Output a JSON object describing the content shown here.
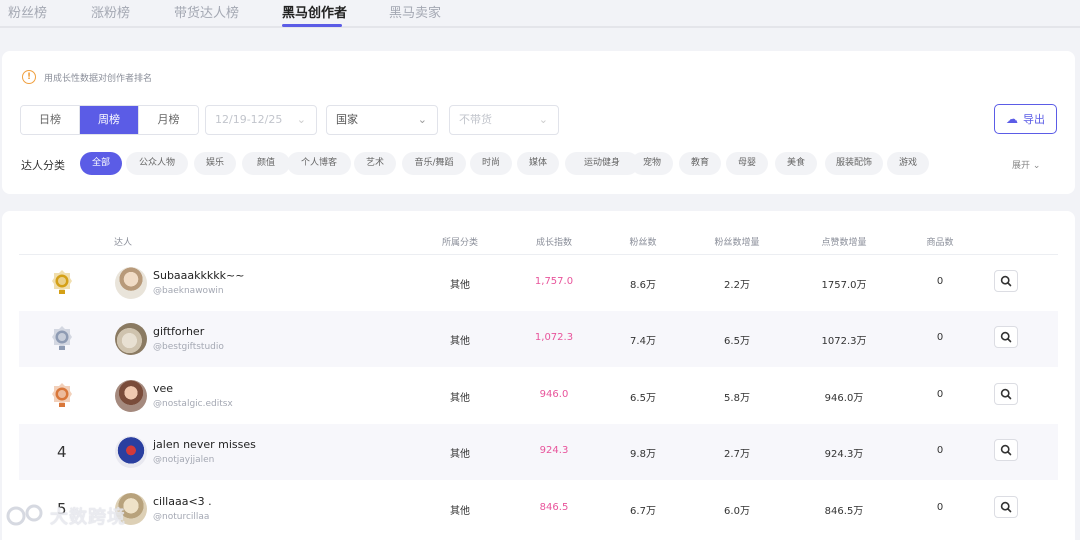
{
  "tabs": {
    "items": [
      "粉丝榜",
      "涨粉榜",
      "带货达人榜",
      "黑马创作者",
      "黑马卖家"
    ],
    "active_index": 3
  },
  "notice": {
    "text": "用成长性数据对创作者排名"
  },
  "period": {
    "items": [
      "日榜",
      "周榜",
      "月榜"
    ],
    "active_index": 1
  },
  "filters": {
    "date_range": "12/19-12/25",
    "country_placeholder": "国家",
    "goods_placeholder": "不带货"
  },
  "export_label": "导出",
  "categories": {
    "label": "达人分类",
    "items": [
      "全部",
      "公众人物",
      "娱乐",
      "颜值",
      "个人博客",
      "艺术",
      "音乐/舞蹈",
      "时尚",
      "媒体",
      "运动健身",
      "宠物",
      "教育",
      "母婴",
      "美食",
      "服装配饰",
      "游戏"
    ],
    "active_index": 0,
    "expand_label": "展开"
  },
  "table": {
    "headers": [
      "达人",
      "所属分类",
      "成长指数",
      "粉丝数",
      "粉丝数增量",
      "点赞数增量",
      "商品数"
    ],
    "rows": [
      {
        "rank": "",
        "medal": "gold",
        "name": "Subaaakkkkk~~",
        "handle": "@baeknawowin",
        "category": "其他",
        "growth": "1,757.0",
        "fans": "8.6万",
        "fans_inc": "2.2万",
        "likes_inc": "1757.0万",
        "goods": "0"
      },
      {
        "rank": "",
        "medal": "silver",
        "name": "giftforher",
        "handle": "@bestgiftstudio",
        "category": "其他",
        "growth": "1,072.3",
        "fans": "7.4万",
        "fans_inc": "6.5万",
        "likes_inc": "1072.3万",
        "goods": "0"
      },
      {
        "rank": "",
        "medal": "bronze",
        "name": "vee",
        "handle": "@nostalgic.editsx",
        "category": "其他",
        "growth": "946.0",
        "fans": "6.5万",
        "fans_inc": "5.8万",
        "likes_inc": "946.0万",
        "goods": "0"
      },
      {
        "rank": "4",
        "medal": "",
        "name": "jalen never misses",
        "handle": "@notjayjjalen",
        "category": "其他",
        "growth": "924.3",
        "fans": "9.8万",
        "fans_inc": "2.7万",
        "likes_inc": "924.3万",
        "goods": "0"
      },
      {
        "rank": "5",
        "medal": "",
        "name": "cillaaa<3 .",
        "handle": "@noturcillaa",
        "category": "其他",
        "growth": "846.5",
        "fans": "6.7万",
        "fans_inc": "6.0万",
        "likes_inc": "846.5万",
        "goods": "0"
      }
    ]
  },
  "watermark": {
    "text": "大数跨境"
  },
  "colors": {
    "accent": "#5b5ce6",
    "growth": "#e8549b",
    "gold": "#d4a017",
    "silver": "#8e9bb3",
    "bronze": "#d9773a"
  }
}
